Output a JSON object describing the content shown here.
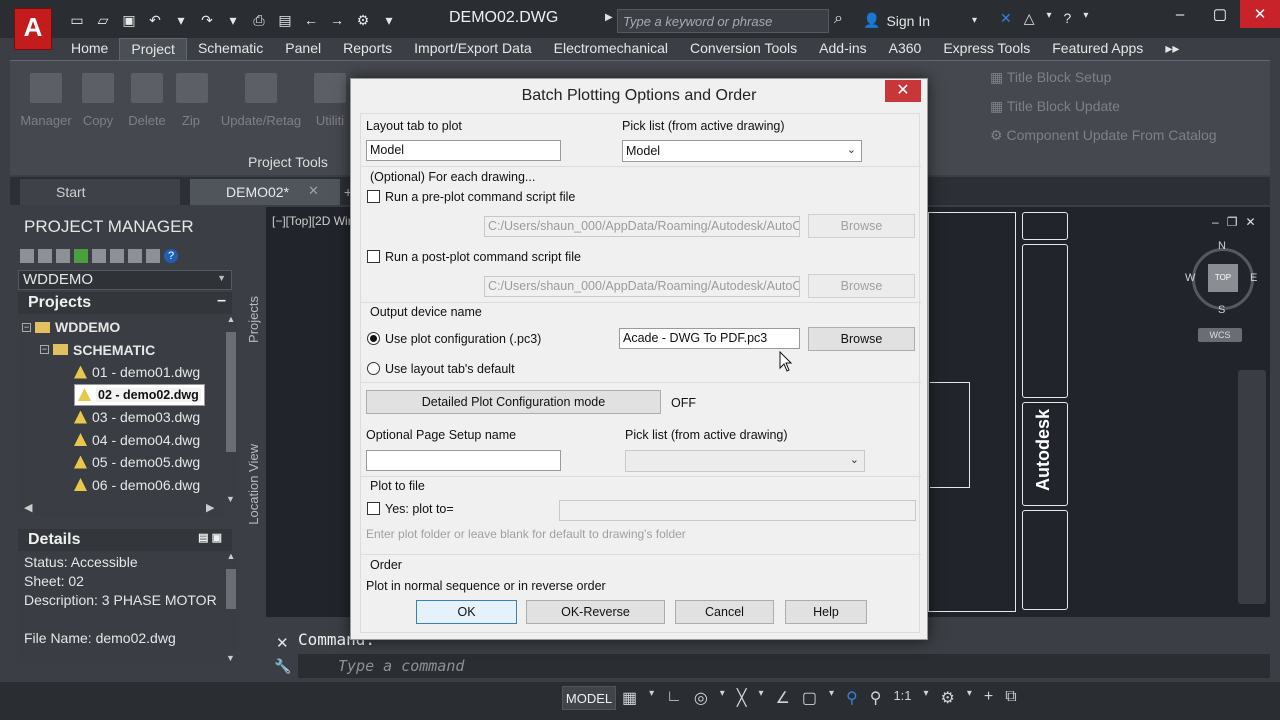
{
  "window": {
    "doc_title": "DEMO02.DWG",
    "search_placeholder": "Type a keyword or phrase",
    "sign_in": "Sign In",
    "app_letter": "A"
  },
  "ribbon_tabs": [
    "Home",
    "Project",
    "Schematic",
    "Panel",
    "Reports",
    "Import/Export Data",
    "Electromechanical",
    "Conversion Tools",
    "Add-ins",
    "A360",
    "Express Tools",
    "Featured Apps"
  ],
  "ribbon_tab_active": "Project",
  "ribbon": {
    "items": [
      "Manager",
      "Copy",
      "Delete",
      "Zip",
      "Update/Retag",
      "Utiliti"
    ],
    "panel_label": "Project Tools",
    "right_items": [
      "Title Block Setup",
      "Title Block Update",
      "Component Update From Catalog"
    ]
  },
  "file_tabs": {
    "start": "Start",
    "current": "DEMO02*"
  },
  "project_manager": {
    "title": "PROJECT MANAGER",
    "selector": "WDDEMO",
    "projects_header": "Projects",
    "tree": [
      {
        "label": "WDDEMO",
        "type": "project"
      },
      {
        "label": "SCHEMATIC",
        "type": "folder"
      },
      {
        "label": "01 - demo01.dwg",
        "type": "dwg"
      },
      {
        "label": "02 - demo02.dwg",
        "type": "dwg",
        "selected": true
      },
      {
        "label": "03 - demo03.dwg",
        "type": "dwg"
      },
      {
        "label": "04 - demo04.dwg",
        "type": "dwg"
      },
      {
        "label": "05 - demo05.dwg",
        "type": "dwg"
      },
      {
        "label": "06 - demo06.dwg",
        "type": "dwg"
      }
    ],
    "details_header": "Details",
    "details": {
      "status": "Status: Accessible",
      "sheet": "Sheet: 02",
      "description": "Description: 3 PHASE MOTOR",
      "file_name": "File Name: demo02.dwg"
    },
    "side_tab_projects": "Projects",
    "side_tab_location": "Location View"
  },
  "viewport": {
    "label": "[−][Top][2D Wir",
    "compass": {
      "n": "N",
      "s": "S",
      "e": "E",
      "w": "W",
      "top": "TOP"
    },
    "wcs": "WCS",
    "title_block_text": "Autodesk"
  },
  "command": {
    "history": "Command:",
    "placeholder": "Type a command"
  },
  "status": {
    "model": "MODEL",
    "scale": "1:1"
  },
  "dialog": {
    "title": "Batch Plotting Options and Order",
    "layout_tab_label": "Layout tab to plot",
    "layout_tab_value": "Model",
    "pick_list_label": "Pick list (from active drawing)",
    "pick_list_value": "Model",
    "optional_header": "(Optional) For each drawing...",
    "preplot_label": "Run a pre-plot command script file",
    "preplot_path": "C:/Users/shaun_000/AppData/Roaming/Autodesk/AutoC",
    "browse": "Browse",
    "postplot_label": "Run a post-plot command script file",
    "postplot_path": "C:/Users/shaun_000/AppData/Roaming/Autodesk/AutoC",
    "output_header": "Output device name",
    "use_pc3_label": "Use plot configuration (.pc3)",
    "pc3_value": "Acade - DWG To PDF.pc3",
    "use_layout_default_label": "Use layout tab's default",
    "detailed_btn": "Detailed Plot Configuration mode",
    "detailed_state": "OFF",
    "page_setup_label": "Optional Page Setup name",
    "page_setup_value": "",
    "pick_list2_label": "Pick list (from active drawing)",
    "plot_to_file_header": "Plot to file",
    "plot_to_label": "Yes: plot to=",
    "plot_to_hint": "Enter plot folder or leave blank for default to drawing's folder",
    "order_header": "Order",
    "order_desc": "Plot in normal sequence or in reverse order",
    "ok": "OK",
    "ok_reverse": "OK-Reverse",
    "cancel": "Cancel",
    "help": "Help"
  },
  "colors": {
    "accent_red": "#c7373a",
    "dark_bg": "#21252b"
  }
}
